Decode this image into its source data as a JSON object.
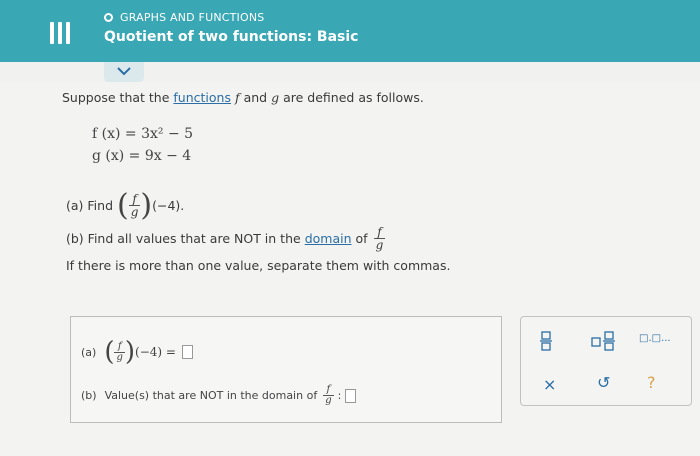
{
  "header": {
    "topic": "GRAPHS AND FUNCTIONS",
    "title": "Quotient of two functions: Basic"
  },
  "problem": {
    "intro_before": "Suppose that the",
    "intro_link": "functions",
    "intro_f": "f",
    "intro_and": "and",
    "intro_g": "g",
    "intro_after": "are defined as follows.",
    "f_def": "f (x) = 3x² − 5",
    "g_def": "g (x) = 9x − 4",
    "part_a_label": "(a) Find",
    "part_a_arg": "(−4).",
    "part_b_label": "(b) Find all values that are NOT in the",
    "part_b_link": "domain",
    "part_b_of": "of",
    "part_b_note": "If there is more than one value, separate them with commas."
  },
  "answer": {
    "a_label": "(a)",
    "a_expr": "(−4) =",
    "b_label": "(b)",
    "b_text": "Value(s) that are NOT in the domain of",
    "b_colon": ":"
  },
  "toolbar": {
    "mixed_label": "□.□...",
    "clear_symbol": "×",
    "undo_symbol": "↺",
    "help_symbol": "?"
  },
  "fraction": {
    "num": "f",
    "den": "g"
  }
}
